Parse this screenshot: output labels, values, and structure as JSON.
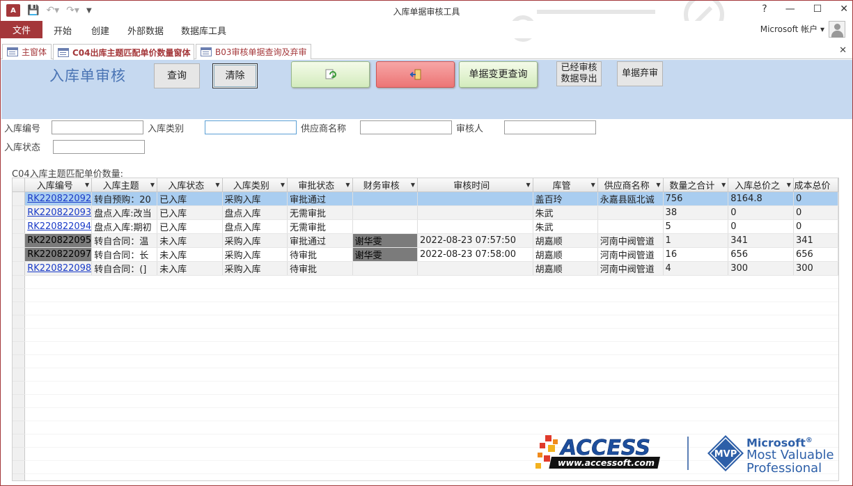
{
  "window": {
    "title": "入库单据审核工具",
    "help": "?"
  },
  "ribbon": {
    "file": "文件",
    "tabs": [
      "开始",
      "创建",
      "外部数据",
      "数据库工具"
    ],
    "account": "Microsoft 帐户"
  },
  "doc_tabs": [
    "主窗体",
    "C04出库主题匹配单价数量窗体",
    "B03审核单据查询及弃审"
  ],
  "header": {
    "title": "入库单审核",
    "query_button": "查询",
    "clear_button": "清除",
    "change_query_button": "单据变更查询",
    "export_button": "已经审核数据导出",
    "abandon_button": "单据弃审"
  },
  "filters": {
    "receipt_no_label": "入库编号",
    "receipt_type_label": "入库类别",
    "supplier_label": "供应商名称",
    "auditor_label": "审核人",
    "status_label": "入库状态"
  },
  "grid": {
    "caption": "C04入库主题匹配单价数量:",
    "columns": [
      "入库编号",
      "入库主题",
      "入库状态",
      "入库类别",
      "审批状态",
      "财务审核",
      "审核时间",
      "库管",
      "供应商名称",
      "数量之合计",
      "入库总价之",
      "成本总价"
    ],
    "rows": [
      [
        "RK220822092",
        "转自预购：20",
        "已入库",
        "采购入库",
        "审批通过",
        "",
        "",
        "盖百玲",
        "永嘉县瓯北诚",
        "756",
        "8164.8",
        "0"
      ],
      [
        "RK220822093",
        "盘点入库:改当",
        "已入库",
        "盘点入库",
        "无需审批",
        "",
        "",
        "朱武",
        "",
        "38",
        "0",
        "0"
      ],
      [
        "RK220822094",
        "盘点入库:期初",
        "已入库",
        "盘点入库",
        "无需审批",
        "",
        "",
        "朱武",
        "",
        "5",
        "0",
        "0"
      ],
      [
        "RK220822095",
        "转自合同：温",
        "未入库",
        "采购入库",
        "审批通过",
        "谢华雯",
        "2022-08-23 07:57:50",
        "胡嘉顺",
        "河南中阀管道",
        "1",
        "341",
        "341"
      ],
      [
        "RK220822097",
        "转自合同：长",
        "未入库",
        "采购入库",
        "待审批",
        "谢华雯",
        "2022-08-23 07:58:00",
        "胡嘉顺",
        "河南中阀管道",
        "16",
        "656",
        "656"
      ],
      [
        "RK220822098",
        "转自合同：(]",
        "未入库",
        "采购入库",
        "待审批",
        "",
        "",
        "胡嘉顺",
        "河南中阀管道",
        "4",
        "300",
        "300"
      ]
    ]
  },
  "logos": {
    "access_word": "ACCESS",
    "access_url": "www.accessoft.com",
    "mvp_badge": "MVP",
    "mvp_company": "Microsoft",
    "mvp_line1": "Most Valuable",
    "mvp_line2": "Professional"
  },
  "colors": {
    "accent": "#a4373a",
    "header_band": "#c6d9f0",
    "selected_row": "#a9cdf0",
    "link": "#1a3bc8"
  }
}
